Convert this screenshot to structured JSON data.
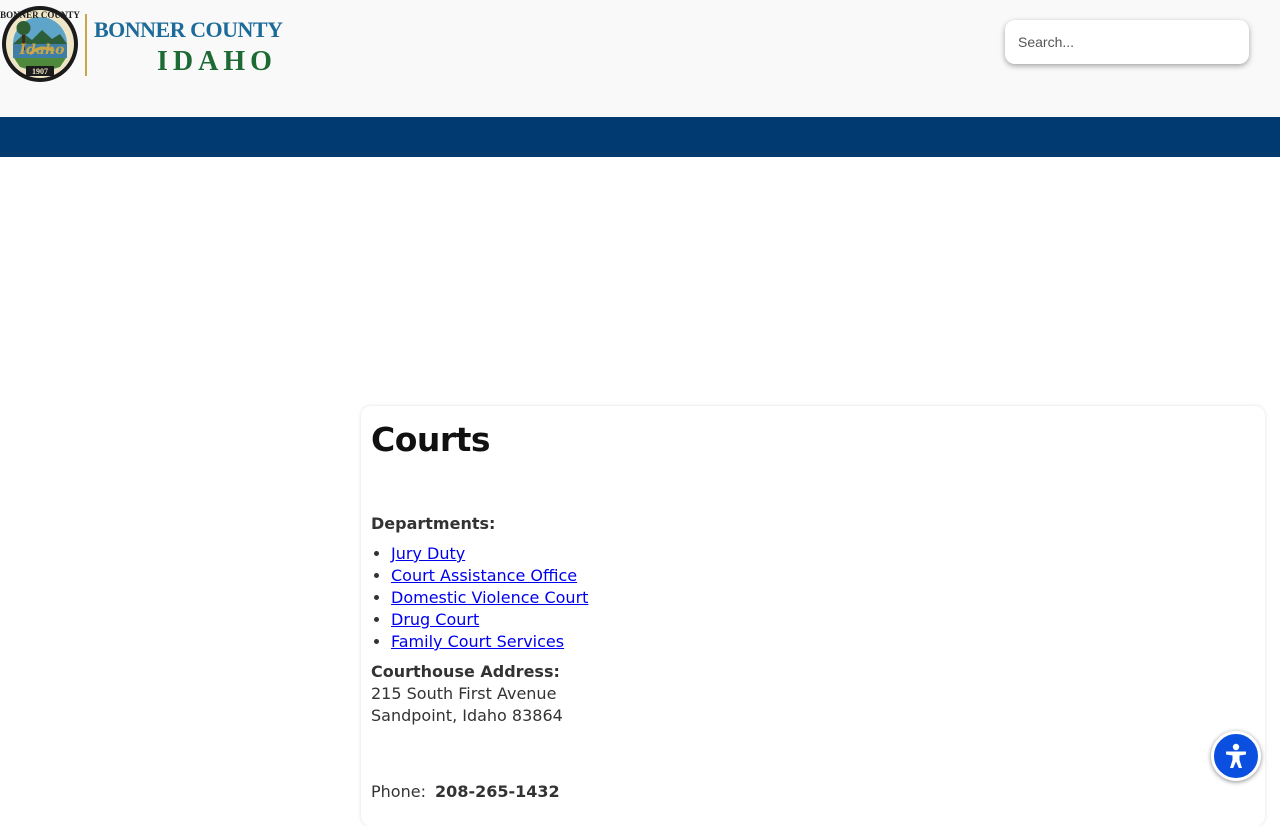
{
  "header": {
    "logo": {
      "line1": "BONNER COUNTY",
      "line2": "IDAHO",
      "seal_ring_text": "BONNER COUNTY",
      "seal_script": "Idaho",
      "seal_year": "1907"
    },
    "search": {
      "placeholder": "Search..."
    }
  },
  "main": {
    "title": "Courts",
    "departments_label": "Departments:",
    "departments": [
      "Jury Duty",
      "Court Assistance Office",
      "Domestic Violence Court",
      "Drug Court",
      "Family Court Services"
    ],
    "address_label": "Courthouse Address:",
    "address_line1": "215 South First Avenue",
    "address_line2": "Sandpoint, Idaho 83864",
    "phone_label": "Phone:",
    "phone_number": "208-265-1432"
  },
  "colors": {
    "navbar": "#003a70",
    "link": "#0000ee",
    "accessibility_button": "#0a4fe0",
    "logo_blue": "#1d6b9a",
    "logo_green": "#1e6a35",
    "logo_gold": "#c9a646"
  },
  "icons": {
    "accessibility": "accessibility-person-icon"
  }
}
